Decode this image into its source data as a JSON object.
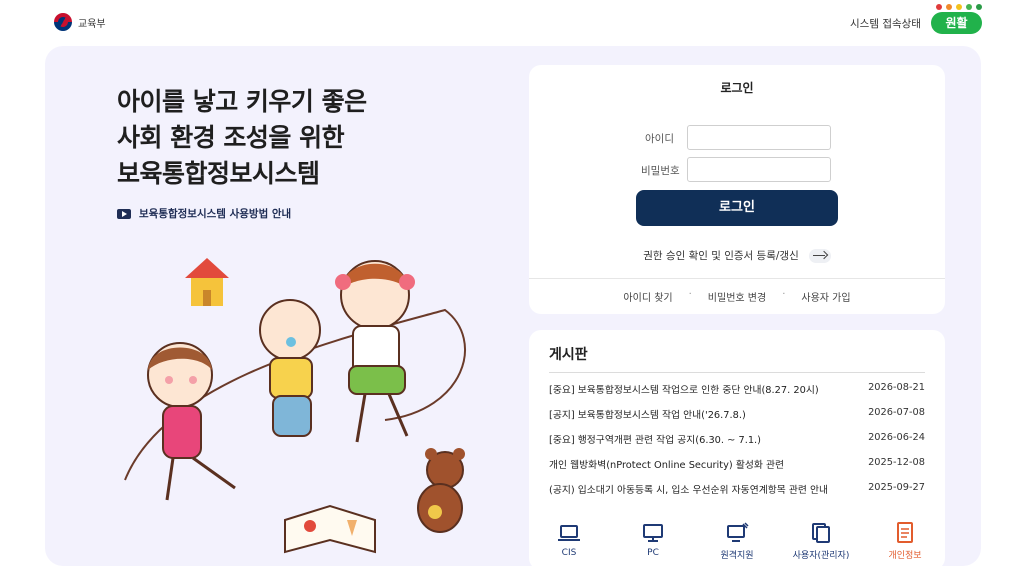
{
  "header": {
    "org_name": "교육부",
    "system_status_label": "시스템 접속상태",
    "status_value": "원활",
    "status_dots": [
      "#e03b3b",
      "#f08a2b",
      "#f3c21c",
      "#46b451",
      "#2a9b47"
    ],
    "status_color": "#21b24b"
  },
  "hero": {
    "lines": [
      "아이를 낳고 키우기 좋은",
      "사회 환경 조성을 위한",
      "보육통합정보시스템"
    ],
    "howto_link": "보육통합정보시스템 사용방법 안내"
  },
  "login": {
    "title": "로그인",
    "id_label": "아이디",
    "id_value": "",
    "pw_label": "비밀번호",
    "pw_value": "",
    "submit_label": "로그인",
    "cert_link": "권한 승인 확인 및 인증서 등록/갱신",
    "links": [
      "아이디 찾기",
      "비밀번호 변경",
      "사용자 가입"
    ],
    "primary_color": "#102f57"
  },
  "board": {
    "title": "게시판",
    "posts": [
      {
        "title": "[중요] 보육통합정보시스템 작업으로 인한 중단 안내(8.27. 20시)",
        "date": "2026-08-21"
      },
      {
        "title": "[공지] 보육통합정보시스템 작업 안내('26.7.8.)",
        "date": "2026-07-08"
      },
      {
        "title": "[중요] 행정구역개편 관련 작업 공지(6.30. ~ 7.1.)",
        "date": "2026-06-24"
      },
      {
        "title": "개인 웹방화벽(nProtect Online Security) 활성화 관련",
        "date": "2025-12-08"
      },
      {
        "title": "(공지) 입소대기 아동등록 시, 입소 우선순위 자동연계항목 관련 안내",
        "date": "2025-09-27"
      }
    ]
  },
  "quick_menu": [
    {
      "label": "CIS",
      "icon": "laptop-icon"
    },
    {
      "label": "PC",
      "icon": "monitor-icon"
    },
    {
      "label": "원격지원",
      "icon": "remote-support-icon"
    },
    {
      "label": "사용자(관리자)",
      "icon": "documents-icon"
    },
    {
      "label": "개인정보",
      "icon": "privacy-document-icon",
      "color": "#e25c2d"
    }
  ]
}
